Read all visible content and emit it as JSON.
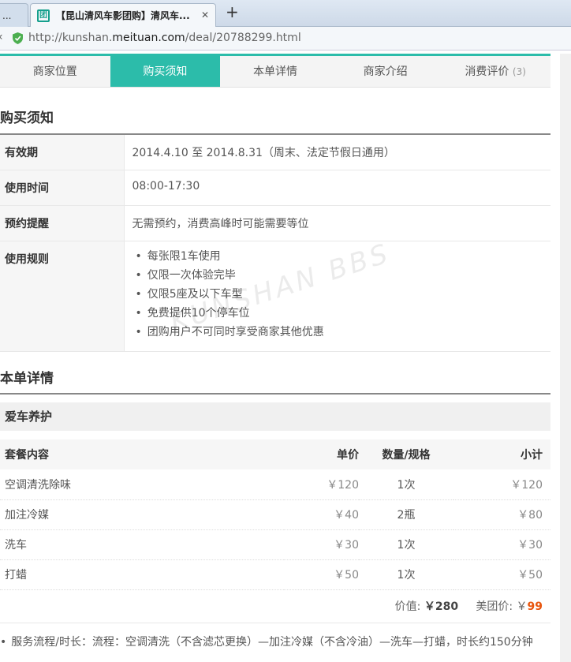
{
  "browser": {
    "prev_tab_label": "...",
    "active_tab_title": "【昆山清风车影团购】清风车...",
    "url_prefix": "http://kunshan.",
    "url_domain": "meituan.com",
    "url_path": "/deal/20788299.html",
    "new_tab": "+",
    "close": "✕",
    "back": "‹"
  },
  "nav": {
    "items": [
      {
        "label": "商家位置"
      },
      {
        "label": "购买须知"
      },
      {
        "label": "本单详情"
      },
      {
        "label": "商家介绍"
      },
      {
        "label": "消费评价",
        "count": "(3)"
      }
    ],
    "active_index": 1,
    "accent_color": "#2cbcaa"
  },
  "notice": {
    "title": "购买须知",
    "rows": [
      {
        "key": "有效期",
        "value": "2014.4.10 至 2014.8.31（周末、法定节假日通用）"
      },
      {
        "key": "使用时间",
        "value": "08:00-17:30"
      },
      {
        "key": "预约提醒",
        "value": "无需预约，消费高峰时可能需要等位"
      },
      {
        "key": "使用规则",
        "rules": [
          "每张限1车使用",
          "仅限一次体验完毕",
          "仅限5座及以下车型",
          "免费提供10个停车位",
          "团购用户不可同时享受商家其他优惠"
        ]
      }
    ]
  },
  "details": {
    "title": "本单详情",
    "category": "爱车养护",
    "headers": [
      "套餐内容",
      "单价",
      "数量/规格",
      "小计"
    ],
    "rows": [
      [
        "空调清洗除味",
        "￥120",
        "1次",
        "￥120"
      ],
      [
        "加注冷媒",
        "￥40",
        "2瓶",
        "￥80"
      ],
      [
        "洗车",
        "￥30",
        "1次",
        "￥30"
      ],
      [
        "打蜡",
        "￥50",
        "1次",
        "￥50"
      ]
    ],
    "value_label": "价值:",
    "value_amount": "￥280",
    "deal_label": "美团价:",
    "deal_currency": "￥",
    "deal_amount": "99",
    "service_text": "服务流程/时长：流程：空调清洗（不含滤芯更换）—加注冷媒（不含冷油）—洗车—打蜡，时长约150分钟"
  },
  "watermark": "KUNSHAN BBS"
}
